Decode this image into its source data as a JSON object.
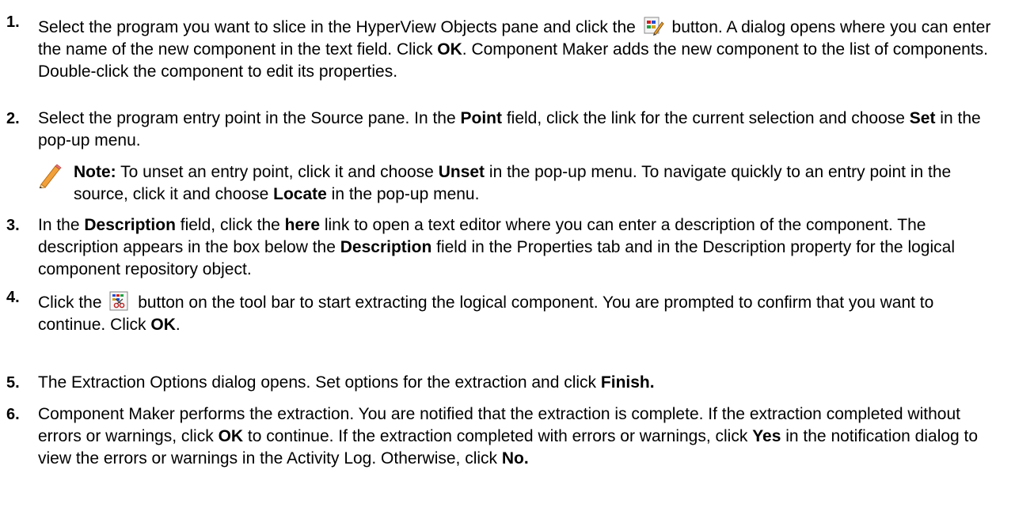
{
  "steps": [
    {
      "number": "1.",
      "p1": "Select the program you want to slice in the HyperView Objects pane and click the ",
      "p2": " button. A dialog opens where you can enter the name of the new component in the text field. Click ",
      "b1": "OK",
      "p3": ". Component Maker adds the new component to the list of components. Double-click the component to edit its properties.",
      "icon": "new-component-icon"
    },
    {
      "number": "2.",
      "p1": "Select the program entry point in the Source pane. In the ",
      "b1": "Point",
      "p2": " field, click the link for the current selection and choose ",
      "b2": "Set",
      "p3": " in the pop-up menu."
    },
    {
      "number": "3.",
      "p1": "In the ",
      "b1": "Description",
      "p2": " field, click the ",
      "b2": "here",
      "p3": " link to open a text editor where you can enter a description of the component. The description appears in the box below the ",
      "b3": "Description",
      "p4": " field in the Properties tab and in the Description property for the logical component repository object."
    },
    {
      "number": "4.",
      "p1": "Click the ",
      "p2": " button on the tool bar to start extracting the logical component. You are prompted to confirm that you want to continue. Click ",
      "b1": "OK",
      "p3": ".",
      "icon": "extract-component-icon"
    },
    {
      "number": "5.",
      "p1": "The Extraction Options dialog opens. Set options for the extraction and click ",
      "b1": "Finish."
    },
    {
      "number": "6.",
      "p1": "Component Maker performs the extraction. You are notified that the extraction is complete. If the extraction completed without errors or warnings, click ",
      "b1": "OK",
      "p2": " to continue. If the extraction completed with errors or warnings, click ",
      "b2": "Yes",
      "p3": " in the notification dialog to view the errors or warnings in the Activity Log. Otherwise, click ",
      "b3": "No."
    }
  ],
  "note": {
    "label": "Note:",
    "p1": " To unset an entry point, click it and choose ",
    "b1": "Unset",
    "p2": " in the pop-up menu. To navigate quickly to an entry point in the source, click it and choose ",
    "b2": "Locate",
    "p3": " in the pop-up menu.",
    "icon": "pencil-icon"
  }
}
